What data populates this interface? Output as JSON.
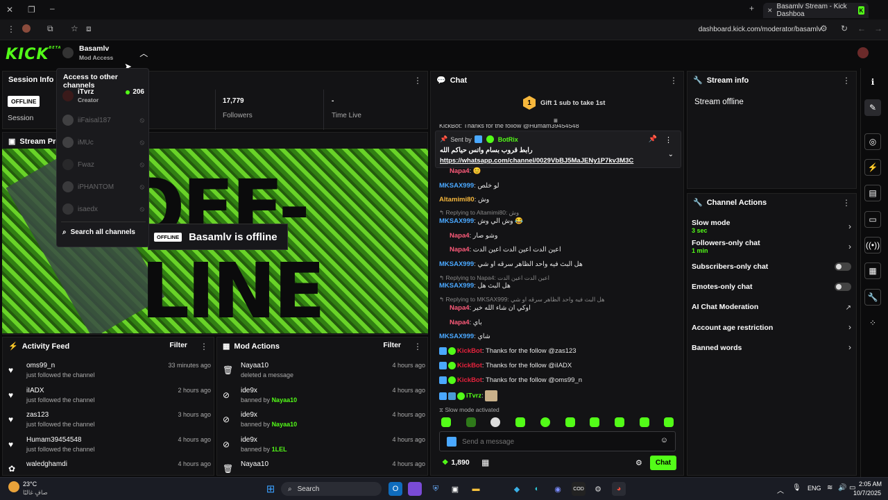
{
  "browser": {
    "tab_title": "Basamlv Stream - Kick Dashboa",
    "url": "dashboard.kick.com/moderator/basamlv",
    "icons": [
      "close-icon",
      "maximize-icon",
      "minimize-icon",
      "new-tab-icon",
      "bookmark-icon",
      "reload-icon",
      "back-icon",
      "forward-icon"
    ]
  },
  "header": {
    "logo": "KICK",
    "logo_tag": "BETA",
    "channel_name": "Basamlv",
    "channel_role": "Mod Access"
  },
  "dropdown": {
    "title": "Access to other channels",
    "channels": [
      {
        "name": "iTvrz",
        "role": "Creator",
        "viewers": "206",
        "live": true
      },
      {
        "name": "iiFaisal187",
        "live": false
      },
      {
        "name": "iMUc",
        "live": false
      },
      {
        "name": "Fwaz",
        "live": false
      },
      {
        "name": "iPHANTOM",
        "live": false
      },
      {
        "name": "isaedx",
        "live": false
      }
    ],
    "search_label": "Search all channels"
  },
  "session_info": {
    "title": "Session Info",
    "status_badge": "OFFLINE",
    "session_label": "Session",
    "followers_value": "17,779",
    "followers_label": "Followers",
    "time_live_value": "-",
    "time_live_label": "Time Live"
  },
  "stream_preview": {
    "title": "Stream Previ",
    "offline_badge": "OFFLINE",
    "offline_text": "Basamlv is offline",
    "bg_text_1": "OFF-",
    "bg_text_2": "LINE"
  },
  "activity_feed": {
    "title": "Activity Feed",
    "filter_label": "Filter",
    "items": [
      {
        "name": "oms99_n",
        "action": "just followed the channel",
        "time": "33 minutes ago"
      },
      {
        "name": "iIADX",
        "action": "just followed the channel",
        "time": "2 hours ago"
      },
      {
        "name": "zas123",
        "action": "just followed the channel",
        "time": "3 hours ago"
      },
      {
        "name": "Humam39454548",
        "action": "just followed the channel",
        "time": "4 hours ago"
      },
      {
        "name": "waledghamdi",
        "action": "",
        "time": "4 hours ago"
      }
    ]
  },
  "mod_actions": {
    "title": "Mod Actions",
    "filter_label": "Filter",
    "items": [
      {
        "name": "Nayaa10",
        "action": "deleted a message",
        "by": "",
        "time": "4 hours ago"
      },
      {
        "name": "ide9x",
        "action": "banned by",
        "by": "Nayaa10",
        "time": "4 hours ago"
      },
      {
        "name": "ide9x",
        "action": "banned by",
        "by": "Nayaa10",
        "time": "4 hours ago"
      },
      {
        "name": "ide9x",
        "action": "banned by",
        "by": "1LEL",
        "time": "4 hours ago"
      },
      {
        "name": "Nayaa10",
        "action": "",
        "by": "",
        "time": "4 hours ago"
      }
    ]
  },
  "chat": {
    "title": "Chat",
    "gift_text": "Gift 1 sub to take 1st",
    "gift_number": "1",
    "partial_top": "KickBot: Thanks for the follow @Humam39454548",
    "pinned": {
      "sent_by": "Sent by",
      "sender": "BotRix",
      "line1": "رابط قروب بسام واتس حياكم الله",
      "link": "https://whatsapp.com/channel/0029VbBJ5MaJENy1P7kv3M3C"
    },
    "messages": [
      {
        "user": "Napa4",
        "text": "😊",
        "color": "#ff5b7a",
        "reply": ""
      },
      {
        "user": "MKSAX999",
        "text": "لو خلص",
        "color": "#4aa8ff",
        "reply": ""
      },
      {
        "user": "Altamimi80",
        "text": "وش",
        "color": "#f6b73c",
        "reply": ""
      },
      {
        "user": "MKSAX999",
        "text": "وش الي وش 😂",
        "color": "#4aa8ff",
        "reply": "Replying to Altamimi80: وش"
      },
      {
        "user": "Napa4",
        "text": "وشو صار",
        "color": "#ff5b7a",
        "reply": ""
      },
      {
        "user": "Napa4",
        "text": "اعين الدت اعين الدت اعين الدت",
        "color": "#ff5b7a",
        "reply": ""
      },
      {
        "user": "MKSAX999",
        "text": "هل البث فيه واحد الظاهر سرقه او شي",
        "color": "#4aa8ff",
        "reply": ""
      },
      {
        "user": "MKSAX999",
        "text": "هل البث هل",
        "color": "#4aa8ff",
        "reply": "Replying to Napa4: اعين الدت اعين الدت"
      },
      {
        "user": "Napa4",
        "text": "اوكي ان شاء الله خير",
        "color": "#ff5b7a",
        "reply": "Replying to MKSAX999: هل البث فيه واحد الظاهر سرقه او شي"
      },
      {
        "user": "Napa4",
        "text": "باي",
        "color": "#ff5b7a",
        "reply": ""
      },
      {
        "user": "MKSAX999",
        "text": "شاي",
        "color": "#4aa8ff",
        "reply": ""
      },
      {
        "user": "KickBot",
        "text": "Thanks for the follow @zas123",
        "color": "#e5223c",
        "reply": ""
      },
      {
        "user": "KickBot",
        "text": "Thanks for the follow @iIADX",
        "color": "#e5223c",
        "reply": ""
      },
      {
        "user": "KickBot",
        "text": "Thanks for the follow @oms99_n",
        "color": "#e5223c",
        "reply": ""
      },
      {
        "user": "iTvrz",
        "text": "",
        "color": "#53fc18",
        "reply": ""
      }
    ],
    "slow_mode_notice": "Slow mode activated",
    "input_placeholder": "Send a message",
    "points": "1,890",
    "send_label": "Chat"
  },
  "stream_info": {
    "title": "Stream info",
    "status": "Stream offline"
  },
  "channel_actions": {
    "title": "Channel Actions",
    "items": [
      {
        "label": "Slow mode",
        "value": "3 sec",
        "control": "arrow"
      },
      {
        "label": "Followers-only chat",
        "value": "1 min",
        "control": "arrow"
      },
      {
        "label": "Subscribers-only chat",
        "value": "",
        "control": "toggle"
      },
      {
        "label": "Emotes-only chat",
        "value": "",
        "control": "toggle"
      },
      {
        "label": "AI Chat Moderation",
        "value": "",
        "control": "external"
      },
      {
        "label": "Account age restriction",
        "value": "",
        "control": "arrow"
      },
      {
        "label": "Banned words",
        "value": "",
        "control": "arrow"
      }
    ]
  },
  "taskbar": {
    "weather_temp": "23°C",
    "weather_desc": "صافٍ غالبًا",
    "search_label": "Search",
    "lang": "ENG",
    "time": "2:05 AM",
    "date": "10/7/2025"
  },
  "colors": {
    "brand": "#53fc18",
    "panel": "#131315",
    "bg": "#0b0b0c"
  }
}
